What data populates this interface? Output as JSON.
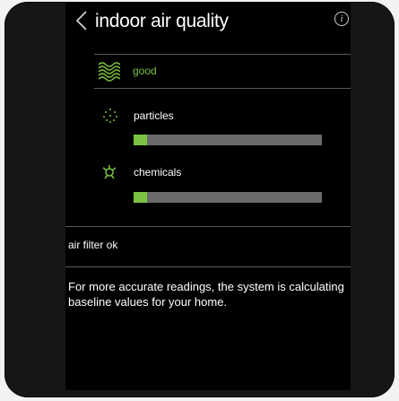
{
  "header": {
    "title": "indoor air quality",
    "info_symbol": "i"
  },
  "air_quality": {
    "status": "good",
    "icon": "air-waves-icon",
    "color": "#7cc242"
  },
  "metrics": [
    {
      "label": "particles",
      "icon": "particles-icon",
      "level": 0.07
    },
    {
      "label": "chemicals",
      "icon": "chemicals-icon",
      "level": 0.07
    }
  ],
  "filter_status": "air filter ok",
  "note": "For more accurate readings, the system is calculating baseline values for your home."
}
